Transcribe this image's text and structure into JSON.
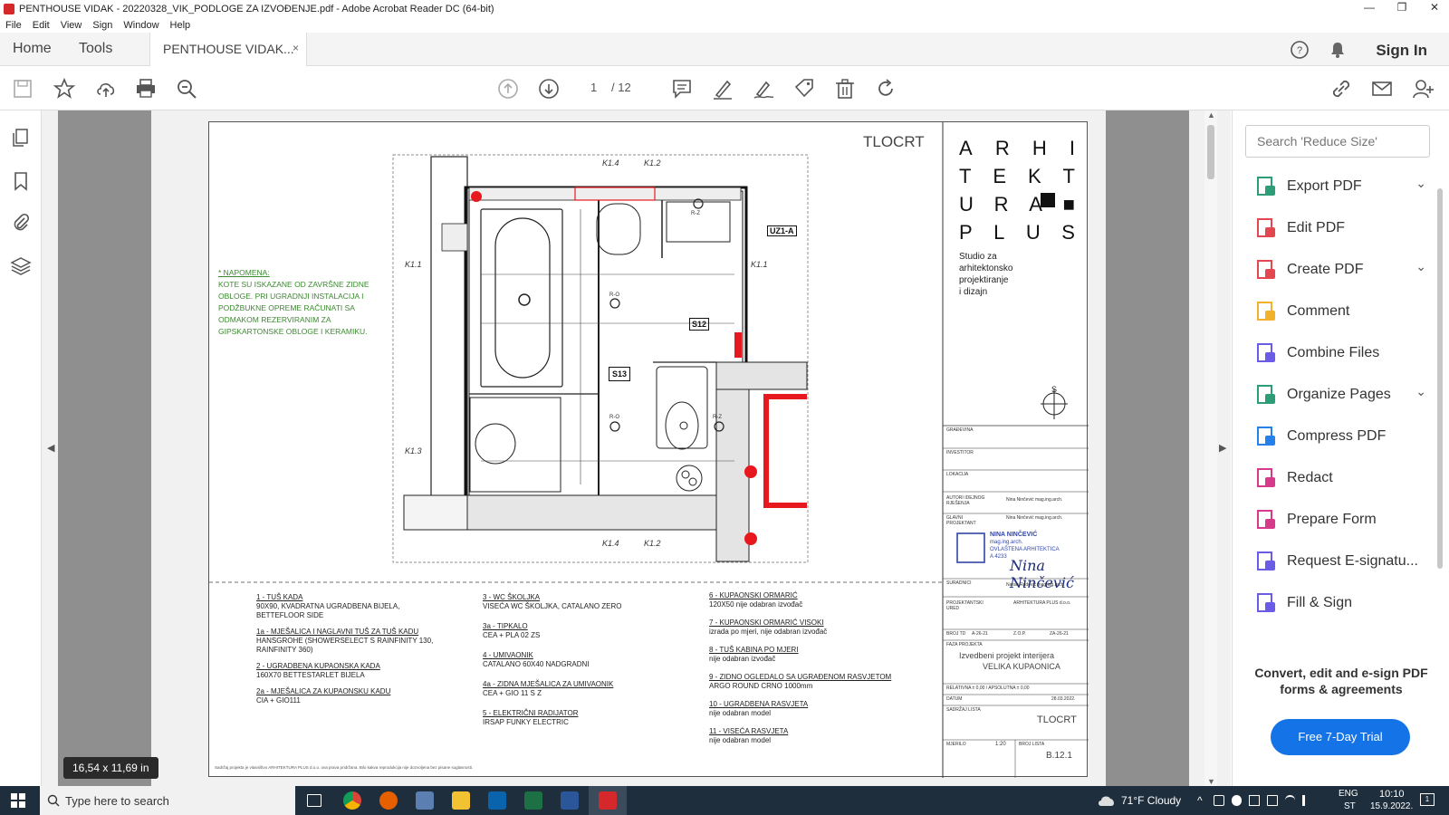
{
  "window": {
    "title": "PENTHOUSE VIDAK - 20220328_VIK_PODLOGE ZA IZVOĐENJE.pdf - Adobe Acrobat Reader DC (64-bit)",
    "controls": [
      "—",
      "❐",
      "✕"
    ]
  },
  "menu": [
    "File",
    "Edit",
    "View",
    "Sign",
    "Window",
    "Help"
  ],
  "tabs": {
    "home": "Home",
    "tools": "Tools",
    "doc": "PENTHOUSE VIDAK...",
    "close": "×",
    "sign_in": "Sign In"
  },
  "toolbar": {
    "page_current": "1",
    "page_total": "/ 12"
  },
  "document": {
    "title": "TLOCRT",
    "logo_letters": [
      "A",
      "R",
      "H",
      "I",
      "T",
      "E",
      "K",
      "T",
      "U",
      "R",
      "A",
      "■",
      "P",
      "L",
      "U",
      "S"
    ],
    "studio": [
      "Studio za",
      "arhitektonsko",
      "projektiranje",
      "i dizajn"
    ],
    "note_title": "* NAPOMENA:",
    "note_lines": [
      "KOTE SU ISKAZANE OD ZAVRŠNE ZIDNE",
      "OBLOGE. PRI UGRADNJI INSTALACIJA I",
      "PODŽBUKNE OPREME RAČUNATI SA",
      "ODMAKOM REZERVIRANIM ZA",
      "GIPSKARTONSKE OBLOGE I KERAMIKU."
    ],
    "legend_col1": [
      {
        "t": "1 - TUŠ KADA",
        "d": [
          "90X90, KVADRATNA UGRADBENA BIJELA,",
          "BETTEFLOOR SIDE"
        ]
      },
      {
        "t": "1a - MJEŠALICA I NAGLAVNI TUŠ ZA TUŠ KADU",
        "d": [
          "HANSGROHE (SHOWERSELECT S RAINFINITY 130,",
          "RAINFINITY 360)"
        ]
      },
      {
        "t": "2 - UGRADBENA KUPAONSKA KADA",
        "d": [
          "160X70 BETTESTARLET BIJELA"
        ]
      },
      {
        "t": "2a - MJEŠALICA ZA KUPAONSKU KADU",
        "d": [
          "CIA + GIO111"
        ]
      }
    ],
    "legend_col2": [
      {
        "t": "3 - WC ŠKOLJKA",
        "d": [
          "VISEĆA WC ŠKOLJKA, CATALANO ZERO"
        ]
      },
      {
        "t": "3a - TIPKALO",
        "d": [
          "CEA + PLA 02 ZS"
        ]
      },
      {
        "t": "4 - UMIVAONIK",
        "d": [
          "CATALANO 60X40 NADGRADNI"
        ]
      },
      {
        "t": "4a - ZIDNA MJEŠALICA ZA UMIVAONIK",
        "d": [
          "CEA + GIO 11 S Z"
        ]
      },
      {
        "t": "5 - ELEKTRIČNI RADIJATOR",
        "d": [
          "IRSAP FUNKY ELECTRIC"
        ]
      }
    ],
    "legend_col3": [
      {
        "t": "6 - KUPAONSKI ORMARIĆ",
        "d": [
          "120X50 nije odabran izvođač"
        ]
      },
      {
        "t": "7 - KUPAONSKI ORMARIĆ VISOKI",
        "d": [
          "izrada po mjeri, nije odabran izvođač"
        ]
      },
      {
        "t": "8 - TUŠ KABINA PO MJERI",
        "d": [
          "nije odabran izvođač"
        ]
      },
      {
        "t": "9 - ZIDNO OGLEDALO SA UGRAĐENOM RASVJETOM",
        "d": [
          "ARGO ROUND CRNO 1000mm"
        ]
      },
      {
        "t": "10 - UGRADBENA RASVJETA",
        "d": [
          "nije odabran model"
        ]
      },
      {
        "t": "11 - VISEĆA RASVJETA",
        "d": [
          "nije odabran model"
        ]
      }
    ],
    "stamp_name": "NINA NINČEVIĆ",
    "stamp_sub": "mag.ing.arch.",
    "stamp_line": "OVLAŠTENA ARHITEKTICA",
    "stamp_no": "A 4233",
    "signature": "Nina Ninčević",
    "tb_labels": [
      "GRAĐEVINA",
      "INVESTITOR",
      "LOKACIJA",
      "AUTORI IDEJNOG RJEŠENJA",
      "GLAVNI PROJEKTANT",
      "SURADNICI",
      "PROJEKTANTSKI URED",
      "BROJ TD",
      "FAZA PROJEKTA",
      "RELATIVNA ± 0,00 / APSOLUTNA ± 0,00",
      "DATUM",
      "SADRŽAJ LISTA",
      "MJERILO",
      "BROJ LISTA"
    ],
    "tb_author": "Nina Ninčević mag.ing.arch.",
    "tb_chief": "Nina Ninčević mag.ing.arch.",
    "tb_collab": "Naran Radović mag.ing.arch.",
    "tb_office": "ARHITEKTURA PLUS d.o.o.",
    "tb_td": "A-26-21",
    "tb_zop": "Z.O.P.",
    "tb_zop_val": "ZA-26-21",
    "tb_phase": "Izvedbeni projekt interijera",
    "tb_room": "VELIKA KUPAONICA",
    "tb_date": "28.03.2022.",
    "tb_content": "TLOCRT",
    "tb_scale": "1:20",
    "tb_sheet": "B.12.1",
    "footer": "Sadržaj projekta je vlasništvo ARHITEKTURA PLUS d.o.o. ova prava pridržana. Bilo kakva reprodukcija nije dozvoljena bez pisane suglasnosti.",
    "plan_labels": [
      "K1.4",
      "K1.2",
      "K1.1",
      "K1.1",
      "K1.3",
      "K1.4",
      "K1.2",
      "UZ1-A",
      "S13",
      "S12",
      "R-Z",
      "R-O",
      "R-O",
      "R-Z"
    ]
  },
  "page_size_badge": "16,54 x 11,69 in",
  "tools_panel": {
    "search_placeholder": "Search 'Reduce Size'",
    "items": [
      {
        "label": "Export PDF",
        "icon": "export-pdf-icon",
        "color": "#2d9d78",
        "chevron": "⌄"
      },
      {
        "label": "Edit PDF",
        "icon": "edit-pdf-icon",
        "color": "#e34850",
        "chevron": ""
      },
      {
        "label": "Create PDF",
        "icon": "create-pdf-icon",
        "color": "#e34850",
        "chevron": "⌄"
      },
      {
        "label": "Comment",
        "icon": "comment-icon",
        "color": "#f3b02a",
        "chevron": ""
      },
      {
        "label": "Combine Files",
        "icon": "combine-files-icon",
        "color": "#6b5ce7",
        "chevron": ""
      },
      {
        "label": "Organize Pages",
        "icon": "organize-pages-icon",
        "color": "#2d9d78",
        "chevron": "⌄"
      },
      {
        "label": "Compress PDF",
        "icon": "compress-pdf-icon",
        "color": "#2680eb",
        "chevron": ""
      },
      {
        "label": "Redact",
        "icon": "redact-icon",
        "color": "#d73a8b",
        "chevron": ""
      },
      {
        "label": "Prepare Form",
        "icon": "prepare-form-icon",
        "color": "#d73a8b",
        "chevron": ""
      },
      {
        "label": "Request E-signatu...",
        "icon": "request-esign-icon",
        "color": "#6b5ce7",
        "chevron": ""
      },
      {
        "label": "Fill & Sign",
        "icon": "fill-sign-icon",
        "color": "#6b5ce7",
        "chevron": ""
      }
    ],
    "promo": "Convert, edit and e-sign PDF forms & agreements",
    "trial_button": "Free 7-Day Trial"
  },
  "taskbar": {
    "search": "Type here to search",
    "weather": "71°F  Cloudy",
    "lang1": "ENG",
    "lang2": "ST",
    "time": "10:10",
    "date": "15.9.2022.",
    "notif": "1"
  }
}
